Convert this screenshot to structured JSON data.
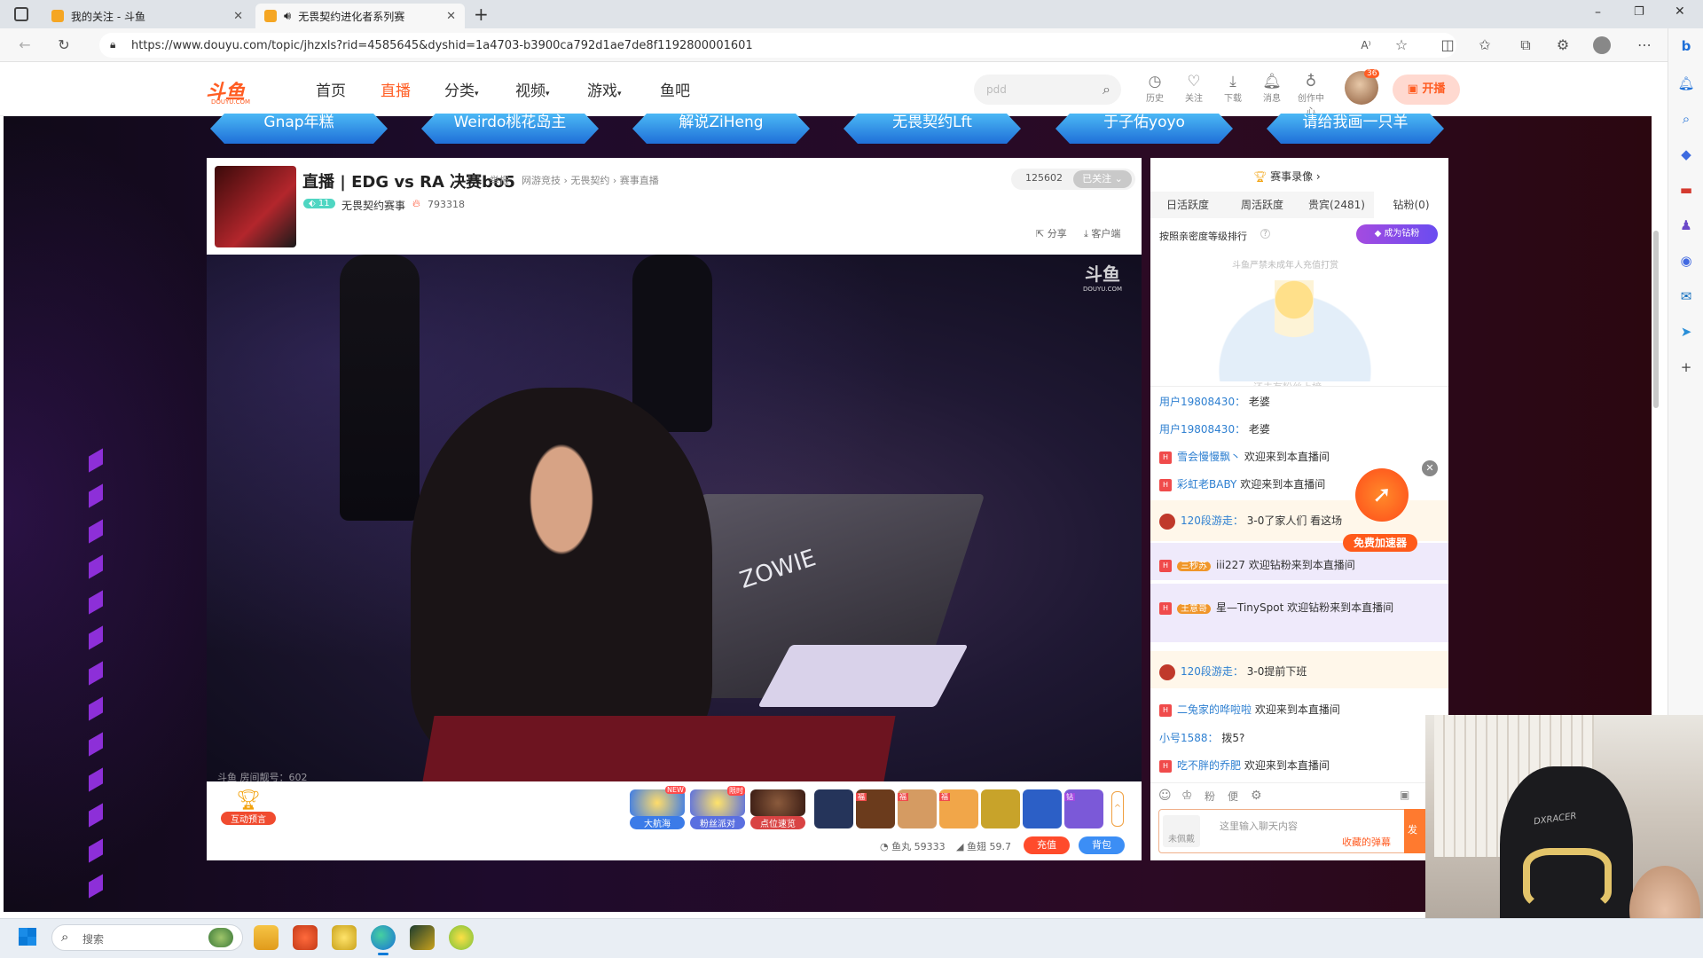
{
  "browser": {
    "tabs": [
      {
        "title": "我的关注 - 斗鱼"
      },
      {
        "title": "无畏契约进化者系列赛"
      }
    ],
    "url": "https://www.douyu.com/topic/jhzxls?rid=4585645&dyshid=1a4703-b3900ca792d1ae7de8f1192800001601"
  },
  "site": {
    "logo_text": "斗鱼",
    "logo_sub": "DOUYU.COM",
    "nav": [
      "首页",
      "直播",
      "分类",
      "视频",
      "游戏",
      "鱼吧"
    ],
    "search_value": "pdd",
    "header_icons": [
      "历史",
      "关注",
      "下载",
      "消息",
      "创作中心"
    ],
    "avatar_badge": "36",
    "start_live": "开播"
  },
  "banners": [
    "Gnap年糕",
    "Weirdo桃花岛主",
    "解说ZiHeng",
    "无畏契约Lft",
    "于子佑yoyo",
    "请给我画一只羊"
  ],
  "stream": {
    "title": "直播 | EDG vs RA 决赛bo5",
    "report": "举报",
    "breadcrumb": "网游竞技 › 无畏契约 › 赛事直播",
    "follow_count": "125602",
    "follow_state": "已关注",
    "level": "11",
    "anchor": "无畏契约赛事",
    "heat": "793318",
    "share": "分享",
    "client": "客户端",
    "watermark": "斗鱼",
    "watermark_sub": "DOUYU.COM",
    "room_label": "斗鱼 房间靓号：602",
    "jersey_text": "ZOWIE"
  },
  "toolbar": {
    "interactive": "互动预言",
    "gifts": [
      {
        "label": "大航海",
        "tag": "NEW",
        "color": "#3b7be8"
      },
      {
        "label": "粉丝派对",
        "tag": "限时",
        "color": "#5a6fe0"
      },
      {
        "label": "点位速览",
        "tag": "",
        "color": "#d94343"
      }
    ],
    "gift_items": [
      {
        "color": "#25345a",
        "tag": ""
      },
      {
        "color": "#6b3b1c",
        "tag": "福"
      },
      {
        "color": "#d59b62",
        "tag": "福"
      },
      {
        "color": "#f1a649",
        "tag": "福"
      },
      {
        "color": "#c8a32a",
        "tag": ""
      },
      {
        "color": "#2c5fc6",
        "tag": ""
      },
      {
        "color": "#7b59d8",
        "tag": "钻"
      }
    ],
    "fishball_label": "鱼丸",
    "fishball": "59333",
    "fishfin_label": "鱼翅",
    "fishfin": "59.7",
    "recharge": "充值",
    "backpack": "背包"
  },
  "side": {
    "replay": "赛事录像 ›",
    "tabs": [
      "日活跃度",
      "周活跃度",
      "贵宾(2481)",
      "钻粉(0)"
    ],
    "rank_note": "按照亲密度等级排行",
    "become": "成为钻粉",
    "minor_note": "斗鱼严禁未成年人充值打赏",
    "empty_hint": "还未有粉丝上榜",
    "chat": [
      {
        "user": "用户19808430：",
        "text": "老婆",
        "badge": ""
      },
      {
        "user": "用户19808430：",
        "text": "老婆",
        "badge": ""
      },
      {
        "user": "雪会慢慢飘丶",
        "text": "欢迎来到本直播间",
        "badge": "H"
      },
      {
        "user": "彩虹老BABY",
        "text": "欢迎来到本直播间",
        "badge": "H"
      },
      {
        "user": "120段游走：",
        "text": "3-0了家人们 看这场",
        "badge": "avatar"
      },
      {
        "user": "iii227",
        "text": "欢迎钻粉来到本直播间",
        "badge": "H",
        "tag": "三秒苏"
      },
      {
        "user": "星—TinySpot",
        "text": "欢迎钻粉来到本直播间",
        "badge": "H",
        "tag": "王意哥"
      },
      {
        "user": "120段游走：",
        "text": "3-0提前下班",
        "badge": "avatar"
      },
      {
        "user": "二兔家的哗啦啦",
        "text": "欢迎来到本直播间",
        "badge": "H"
      },
      {
        "user": "小号1588：",
        "text": "拨5?",
        "badge": ""
      },
      {
        "user": "吃不胖的乔肥",
        "text": "欢迎来到本直播间",
        "badge": "H"
      }
    ],
    "accelerator": "免费加速器",
    "chat_placeholder": "这里输入聊天内容",
    "fav_danmu": "收藏的弹幕",
    "send": "发送",
    "unarmed": "未佩戴"
  },
  "taskbar": {
    "search_placeholder": "搜索"
  },
  "webcam": {
    "chair_brand": "DXRACER"
  }
}
